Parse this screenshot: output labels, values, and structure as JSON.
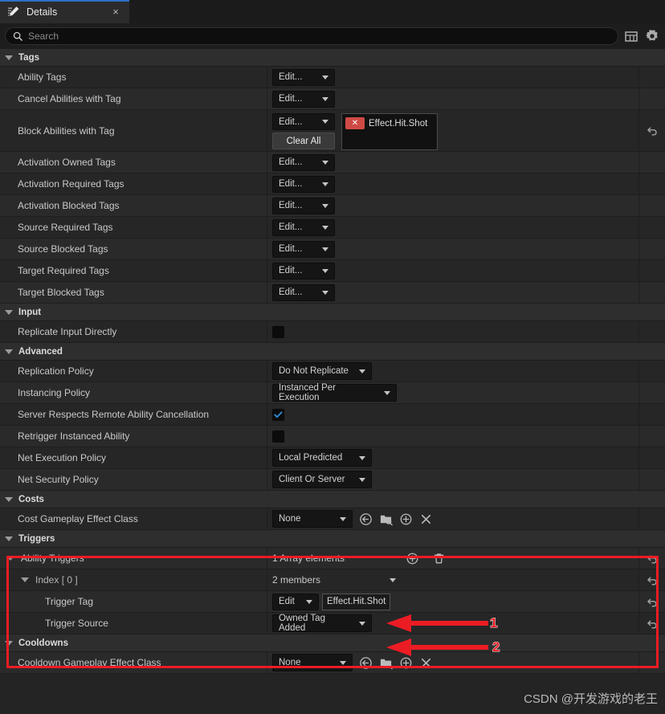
{
  "tab": {
    "title": "Details",
    "icon": "details-pencil-icon",
    "close": "×"
  },
  "search": {
    "placeholder": "Search",
    "icon": "search-icon"
  },
  "header_icons": [
    {
      "name": "column-layout-icon",
      "label": "Column Layout"
    },
    {
      "name": "settings-gear-icon",
      "label": "View Options"
    }
  ],
  "accent": "#2d6ec9",
  "annotation_color": "#ec1c24",
  "sections": [
    {
      "name": "Tags",
      "rows": [
        {
          "label": "Ability Tags",
          "control": "edit",
          "edit_label": "Edit...",
          "reset": false
        },
        {
          "label": "Cancel Abilities with Tag",
          "control": "edit",
          "edit_label": "Edit...",
          "reset": false
        },
        {
          "label": "Block Abilities with Tag",
          "control": "edit_clear_tag",
          "edit_label": "Edit...",
          "clear_label": "Clear All",
          "tag": "Effect.Hit.Shot",
          "reset": true
        },
        {
          "label": "Activation Owned Tags",
          "control": "edit",
          "edit_label": "Edit...",
          "reset": false
        },
        {
          "label": "Activation Required Tags",
          "control": "edit",
          "edit_label": "Edit...",
          "reset": false
        },
        {
          "label": "Activation Blocked Tags",
          "control": "edit",
          "edit_label": "Edit...",
          "reset": false
        },
        {
          "label": "Source Required Tags",
          "control": "edit",
          "edit_label": "Edit...",
          "reset": false
        },
        {
          "label": "Source Blocked Tags",
          "control": "edit",
          "edit_label": "Edit...",
          "reset": false
        },
        {
          "label": "Target Required Tags",
          "control": "edit",
          "edit_label": "Edit...",
          "reset": false
        },
        {
          "label": "Target Blocked Tags",
          "control": "edit",
          "edit_label": "Edit...",
          "reset": false
        }
      ]
    },
    {
      "name": "Input",
      "rows": [
        {
          "label": "Replicate Input Directly",
          "control": "checkbox",
          "checked": false,
          "reset": false
        }
      ]
    },
    {
      "name": "Advanced",
      "rows": [
        {
          "label": "Replication Policy",
          "control": "combo",
          "value": "Do Not Replicate",
          "reset": false
        },
        {
          "label": "Instancing Policy",
          "control": "combo",
          "value": "Instanced Per Execution",
          "reset": false
        },
        {
          "label": "Server Respects Remote Ability Cancellation",
          "control": "checkbox",
          "checked": true,
          "reset": false
        },
        {
          "label": "Retrigger Instanced Ability",
          "control": "checkbox",
          "checked": false,
          "reset": false
        },
        {
          "label": "Net Execution Policy",
          "control": "combo",
          "value": "Local Predicted",
          "reset": false
        },
        {
          "label": "Net Security Policy",
          "control": "combo",
          "value": "Client Or Server",
          "reset": false
        }
      ]
    },
    {
      "name": "Costs",
      "rows": [
        {
          "label": "Cost Gameplay Effect Class",
          "control": "asset",
          "value": "None",
          "reset": false
        }
      ]
    },
    {
      "name": "Triggers",
      "rows": [
        {
          "label": "Ability Triggers",
          "control": "array_header",
          "value": "1 Array elements",
          "indent": 0,
          "expanded": true,
          "reset": true
        },
        {
          "label": "Index [ 0 ]",
          "control": "array_index",
          "value": "2 members",
          "indent": 1,
          "expanded": true,
          "reset": true
        },
        {
          "label": "Trigger Tag",
          "control": "edit_value",
          "edit_label": "Edit",
          "value": "Effect.Hit.Shot",
          "indent": 2,
          "reset": true
        },
        {
          "label": "Trigger Source",
          "control": "combo",
          "value": "Owned Tag Added",
          "indent": 2,
          "reset": true
        }
      ]
    },
    {
      "name": "Cooldowns",
      "rows": [
        {
          "label": "Cooldown Gameplay Effect Class",
          "control": "asset",
          "value": "None",
          "reset": false
        }
      ]
    }
  ],
  "asset_icons": [
    {
      "name": "use-selected-asset-icon"
    },
    {
      "name": "browse-to-asset-icon"
    },
    {
      "name": "new-asset-icon"
    },
    {
      "name": "clear-asset-icon"
    }
  ],
  "array_icons": [
    {
      "name": "add-array-element-icon"
    },
    {
      "name": "delete-array-icon"
    }
  ],
  "annotations": [
    {
      "name": "annotation-arrow-1",
      "number": "1"
    },
    {
      "name": "annotation-arrow-2",
      "number": "2"
    }
  ],
  "watermark": "CSDN @开发游戏的老王"
}
